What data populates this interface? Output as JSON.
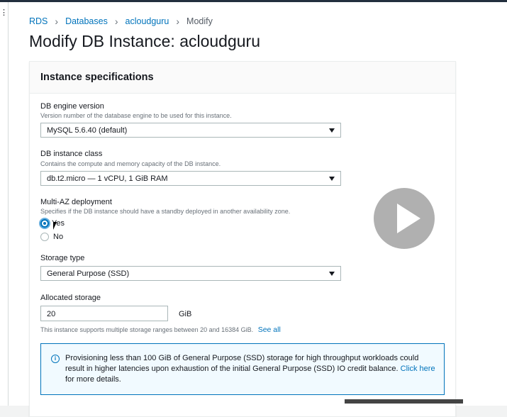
{
  "breadcrumb": {
    "items": [
      "RDS",
      "Databases",
      "acloudguru"
    ],
    "current": "Modify"
  },
  "page": {
    "title": "Modify DB Instance: acloudguru"
  },
  "panel": {
    "title": "Instance specifications"
  },
  "engine": {
    "label": "DB engine version",
    "description": "Version number of the database engine to be used for this instance.",
    "value": "MySQL 5.6.40 (default)"
  },
  "instance_class": {
    "label": "DB instance class",
    "description": "Contains the compute and memory capacity of the DB instance.",
    "value": "db.t2.micro — 1 vCPU, 1 GiB RAM"
  },
  "multi_az": {
    "label": "Multi-AZ deployment",
    "description": "Specifies if the DB instance should have a standby deployed in another availability zone.",
    "options": [
      "Yes",
      "No"
    ],
    "selected": "Yes"
  },
  "storage_type": {
    "label": "Storage type",
    "value": "General Purpose (SSD)"
  },
  "allocated_storage": {
    "label": "Allocated storage",
    "value": "20",
    "unit": "GiB",
    "hint": "This instance supports multiple storage ranges between 20 and 16384 GiB.",
    "see_all": "See all"
  },
  "alert": {
    "text_before": "Provisioning less than 100 GiB of General Purpose (SSD) storage for high throughput workloads could result in higher latencies upon exhaustion of the initial General Purpose (SSD) IO credit balance.",
    "link": "Click here",
    "text_after": "for more details."
  },
  "icons": {
    "info": "info-circle-icon",
    "play": "play-icon",
    "menu": "kebab-menu-icon"
  },
  "colors": {
    "link": "#0073bb",
    "header": "#232f3e",
    "alert_border": "#0073bb"
  }
}
